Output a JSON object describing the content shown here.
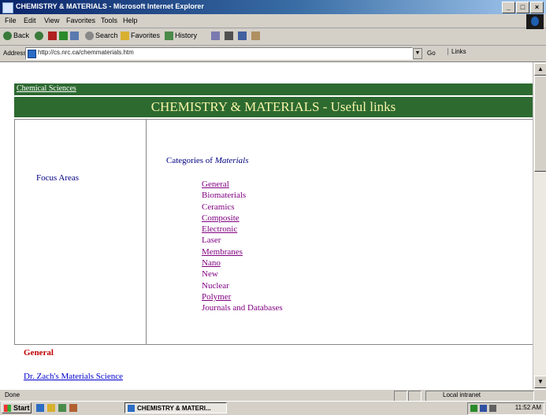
{
  "window": {
    "title": "CHEMISTRY & MATERIALS - Microsoft Internet Explorer",
    "controls": [
      "_",
      "□",
      "×"
    ]
  },
  "menu": [
    "File",
    "Edit",
    "View",
    "Favorites",
    "Tools",
    "Help"
  ],
  "toolbar": {
    "back": "Back",
    "search": "Search",
    "favorites": "Favorites",
    "history": "History"
  },
  "address": {
    "label": "Address",
    "url": "http://cs.nrc.ca/chemmaterials.htm",
    "go": "Go",
    "links": "Links"
  },
  "page": {
    "section_bar": "Chemical Sciences",
    "heading": "CHEMISTRY & MATERIALS - Useful links",
    "left_label": "Focus Areas",
    "categories_prefix": "Categories of ",
    "categories_em": "Materials",
    "categories": [
      {
        "label": "General",
        "underlined": true
      },
      {
        "label": "Biomaterials",
        "underlined": false
      },
      {
        "label": "Ceramics",
        "underlined": false
      },
      {
        "label": "Composite",
        "underlined": true
      },
      {
        "label": "Electronic",
        "underlined": true
      },
      {
        "label": "Laser",
        "underlined": false
      },
      {
        "label": "Membranes",
        "underlined": true
      },
      {
        "label": "Nano",
        "underlined": true
      },
      {
        "label": "New",
        "underlined": false
      },
      {
        "label": "Nuclear",
        "underlined": false
      },
      {
        "label": "Polymer",
        "underlined": true
      },
      {
        "label": "Journals and Databases",
        "underlined": false
      }
    ],
    "general_heading": "General",
    "general_link": "Dr. Zach's Materials Science"
  },
  "status": {
    "text": "Done",
    "zone": "Local intranet"
  },
  "taskbar": {
    "start": "Start",
    "task": "CHEMISTRY & MATERI...",
    "clock": "11:52 AM"
  },
  "colors": {
    "header_green": "#2d6a30",
    "heading_text": "#f7f4a8",
    "visited_link": "#800080",
    "general_red": "#c00000"
  }
}
